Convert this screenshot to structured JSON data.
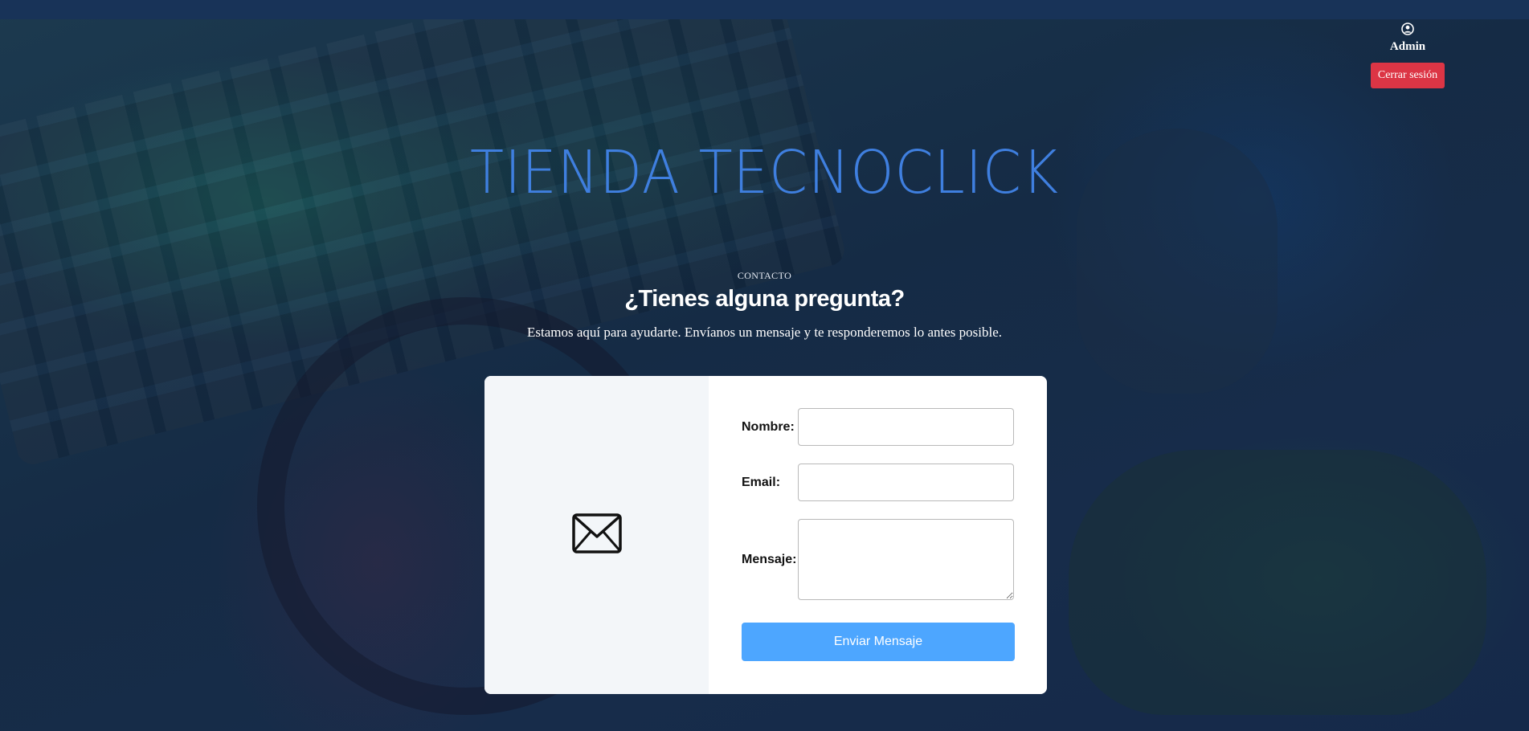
{
  "header": {
    "user_icon": "user-circle-icon",
    "user_name": "Admin",
    "logout_label": "Cerrar sesión"
  },
  "brand": {
    "title": "TIENDA TECNOCLICK"
  },
  "contact": {
    "eyebrow": "CONTACTO",
    "heading": "¿Tienes alguna pregunta?",
    "lead": "Estamos aquí para ayudarte. Envíanos un mensaje y te responderemos lo antes posible.",
    "icon": "envelope-icon"
  },
  "form": {
    "name_label": "Nombre:",
    "name_value": "",
    "email_label": "Email:",
    "email_value": "",
    "message_label": "Mensaje:",
    "message_value": "",
    "submit_label": "Enviar Mensaje"
  },
  "colors": {
    "brand_blue": "#3f7fdf",
    "logout_red": "#dc3545",
    "submit_blue": "#4da6ff",
    "topbar": "#183358"
  }
}
